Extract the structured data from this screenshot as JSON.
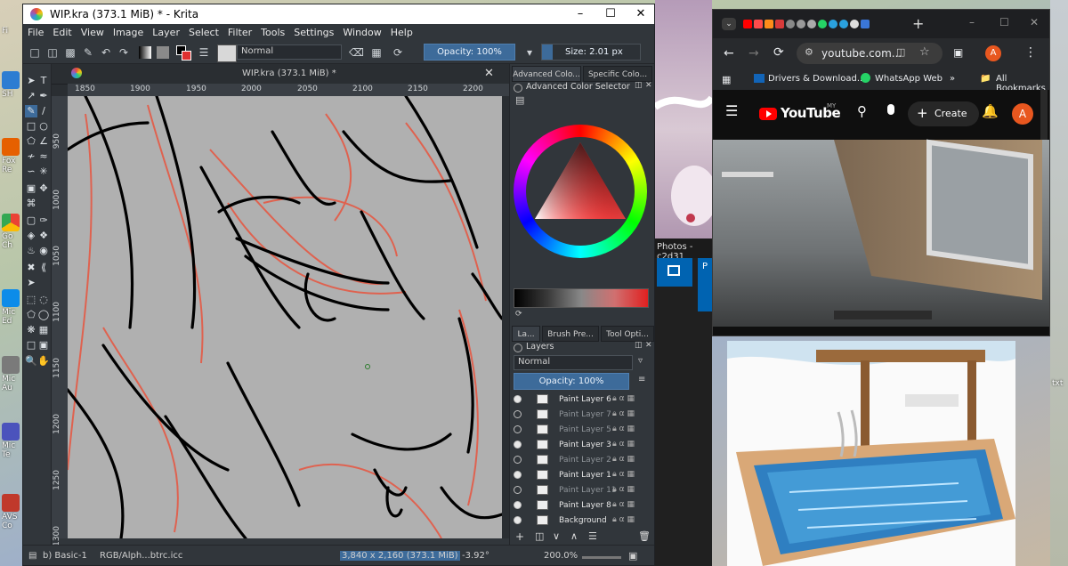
{
  "krita": {
    "title": "WIP.kra (373.1 MiB) * - Krita",
    "menu": [
      "File",
      "Edit",
      "View",
      "Image",
      "Layer",
      "Select",
      "Filter",
      "Tools",
      "Settings",
      "Window",
      "Help"
    ],
    "toolbar": {
      "blend_mode": "Normal",
      "opacity": "Opacity: 100%",
      "size": "Size: 2.01 px"
    },
    "doc_tab_title": "WIP.kra (373.1 MiB) *",
    "ruler_top": [
      "1850",
      "1900",
      "1950",
      "2000",
      "2050",
      "2100",
      "2150",
      "2200"
    ],
    "ruler_left": [
      "950",
      "1000",
      "1050",
      "1100",
      "1150",
      "1200",
      "1250",
      "1300"
    ],
    "dock_tabs_top": [
      "Advanced Colo...",
      "Specific Colo..."
    ],
    "color_selector_title": "Advanced Color Selector",
    "dock_tabs_bottom": [
      "La...",
      "Brush Pre...",
      "Tool Opti..."
    ],
    "layers_title": "Layers",
    "layers_blend": "Normal",
    "layers_opacity": "Opacity:  100%",
    "layers": [
      {
        "name": "Paint Layer 6",
        "visible": true
      },
      {
        "name": "Paint Layer 7",
        "visible": false
      },
      {
        "name": "Paint Layer 5",
        "visible": false
      },
      {
        "name": "Paint Layer 3",
        "visible": true
      },
      {
        "name": "Paint Layer 2",
        "visible": false
      },
      {
        "name": "Paint Layer 1",
        "visible": true
      },
      {
        "name": "Paint Layer 11",
        "visible": false
      },
      {
        "name": "Paint Layer 8",
        "visible": true
      },
      {
        "name": "Background",
        "visible": true
      }
    ],
    "status": {
      "brush": "b) Basic-1",
      "color_profile": "RGB/Alph...btrc.icc",
      "dimensions": "3,840 x 2,160 (373.1 MiB)",
      "rotation": "-3.92°",
      "zoom": "200.0%"
    }
  },
  "middle": {
    "photos_label": "Photos - c2d31",
    "side_letter": "P"
  },
  "browser": {
    "url": "youtube.com...",
    "profile_initial": "A",
    "bookmarks": [
      "Drivers & Download...",
      "WhatsApp Web",
      "All Bookmarks"
    ],
    "youtube": {
      "logo": "YouTube",
      "region": "MY",
      "create_label": "Create",
      "avatar": "A"
    }
  },
  "desktop": {
    "icon_labels": [
      "Fi",
      "SH",
      "Fox",
      "Re",
      "Go",
      "Ch",
      "Mic",
      "Ed",
      "Mic",
      "Au",
      "Mic",
      "Te",
      "AVS",
      "Co",
      "txt"
    ]
  },
  "colors": {
    "krita_bg": "#31363b",
    "accent": "#3d6b9a",
    "youtube_red": "#ff0000",
    "avatar_orange": "#e8571f"
  }
}
